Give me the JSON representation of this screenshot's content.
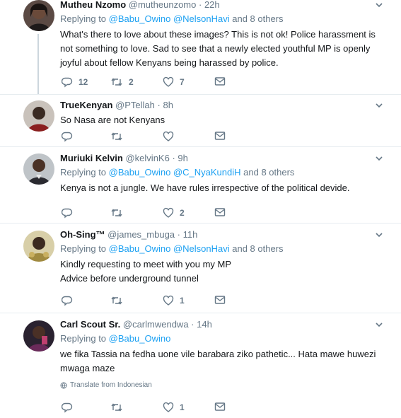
{
  "tweets": [
    {
      "name": "Mutheu Nzomo",
      "handle": "@mutheunzomo",
      "time": "22h",
      "replying_prefix": "Replying to",
      "mentions": [
        "@Babu_Owino",
        "@NelsonHavi"
      ],
      "others": "and 8 others",
      "text": "What's there to love about these images? This is not ok! Police harassment is not something to love. Sad to see that a newly elected youthful MP is openly joyful about fellow Kenyans being harassed by police.",
      "replies": "12",
      "retweets": "2",
      "likes": "7"
    },
    {
      "name": "TrueKenyan",
      "handle": "@PTellah",
      "time": "8h",
      "text": "So Nasa are not Kenyans",
      "replies": "",
      "retweets": "",
      "likes": ""
    },
    {
      "name": "Muriuki Kelvin",
      "handle": "@kelvinK6",
      "time": "9h",
      "replying_prefix": "Replying to",
      "mentions": [
        "@Babu_Owino",
        "@C_NyaKundiH"
      ],
      "others": "and 8 others",
      "text": "Kenya is not a jungle. We have rules irrespective of the political devide.",
      "replies": "",
      "retweets": "",
      "likes": "2"
    },
    {
      "name": "Oh-Sing™",
      "handle": "@james_mbuga",
      "time": "11h",
      "replying_prefix": "Replying to",
      "mentions": [
        "@Babu_Owino",
        "@NelsonHavi"
      ],
      "others": "and 8 others",
      "text_lines": [
        "Kindly requesting to meet with you my MP",
        "Advice before underground tunnel"
      ],
      "replies": "",
      "retweets": "",
      "likes": "1"
    },
    {
      "name": "Carl Scout Sr.",
      "handle": "@carlmwendwa",
      "time": "14h",
      "replying_prefix": "Replying to",
      "mentions": [
        "@Babu_Owino"
      ],
      "text": "we fika Tassia na fedha uone vile barabara ziko pathetic... Hata mawe huwezi mwaga maze",
      "translate": "Translate from Indonesian",
      "replies": "",
      "retweets": "",
      "likes": "1"
    }
  ],
  "separator": "·",
  "icons": {
    "reply": "reply-icon",
    "retweet": "retweet-icon",
    "like": "heart-icon",
    "dm": "envelope-icon",
    "menu": "chevron-down-icon",
    "translate": "globe-icon"
  },
  "colors": {
    "link": "#1da1f2",
    "muted": "#657786",
    "divider": "#e6ecf0",
    "thread_line": "#ccd6dd"
  }
}
